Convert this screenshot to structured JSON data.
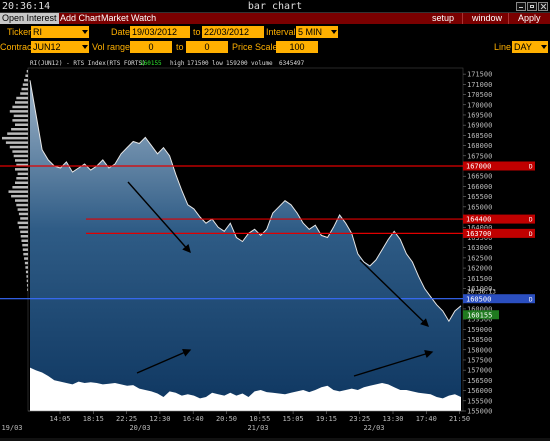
{
  "titlebar": {
    "time": "20:36:14",
    "title": "bar chart"
  },
  "menu": {
    "open_interest": "Open Interest",
    "add_chart": "Add Chart",
    "market_watch": "Market Watch",
    "setup": "setup",
    "window": "window",
    "apply": "Apply"
  },
  "toolbar": {
    "ticker_label": "Ticker",
    "ticker_value": "RI",
    "date_label": "Date",
    "date_from": "19/03/2012",
    "to_label": "to",
    "date_to": "22/03/2012",
    "interval_label": "Interval",
    "interval_value": "5 MIN",
    "contract_label": "Contract",
    "contract_value": "JUN12",
    "vol_range_label": "Vol range",
    "vol_from": "0",
    "vol_to_label": "to",
    "vol_to": "0",
    "price_scale_label": "Price Scale",
    "price_scale_value": "100",
    "line_label": "Line",
    "line_value": "DAY"
  },
  "colors": {
    "accent": "#ffb000",
    "menu_bg": "#7a0000",
    "level_line": "#e00000",
    "current_line": "#3a6cff",
    "last_price_bg": "#1f7a1f"
  },
  "chart_data": {
    "type": "area",
    "info": {
      "symbol": "RI(JUN12) - RTS Index(RTS FORTS)",
      "last": "160155",
      "high_label": "high",
      "high": "171500",
      "low_label": "low",
      "low": "159200",
      "volume_label": "volume",
      "volume": "6345497"
    },
    "ylim": [
      155000,
      171800
    ],
    "y_ticks": [
      "171500",
      "171000",
      "170500",
      "170000",
      "169500",
      "169000",
      "168500",
      "168000",
      "167500",
      "167000",
      "166500",
      "166000",
      "165500",
      "165000",
      "164500",
      "164000",
      "163500",
      "163000",
      "162500",
      "162000",
      "161500",
      "161000",
      "160500",
      "160000",
      "159500",
      "159000",
      "158500",
      "158000",
      "157500",
      "157000",
      "156500",
      "156000",
      "155500",
      "155000"
    ],
    "x_ticks": [
      "14:05",
      "18:15",
      "22:25",
      "12:30",
      "16:40",
      "20:50",
      "10:55",
      "15:05",
      "19:15",
      "23:25",
      "13:30",
      "17:40",
      "21:50"
    ],
    "date_labels": [
      "19/03",
      "20/03",
      "21/03",
      "22/03"
    ],
    "levels": [
      {
        "price": 167000,
        "label": "167000",
        "flag": "D",
        "color": "red"
      },
      {
        "price": 164400,
        "label": "164400",
        "flag": "D",
        "color": "red"
      },
      {
        "price": 163700,
        "label": "163700",
        "flag": "D",
        "color": "red"
      },
      {
        "price": 160500,
        "label": "160500",
        "flag": "D",
        "color": "blue",
        "time": "20:36:13"
      }
    ],
    "last_price": "160155",
    "price_series": [
      171200,
      169500,
      167800,
      167300,
      167000,
      166900,
      167200,
      166700,
      166900,
      167100,
      166800,
      167000,
      167300,
      166900,
      167100,
      167600,
      167900,
      168200,
      168100,
      168400,
      168000,
      167600,
      167900,
      167500,
      166600,
      165800,
      165100,
      164900,
      164500,
      164200,
      164400,
      164000,
      163800,
      164200,
      163500,
      163300,
      163700,
      163900,
      163600,
      163900,
      164700,
      165000,
      165300,
      165100,
      164700,
      164200,
      163900,
      164100,
      163600,
      163500,
      164000,
      164600,
      164200,
      163700,
      162700,
      162300,
      162100,
      162400,
      162900,
      163400,
      163800,
      163400,
      162700,
      162300,
      161600,
      161000,
      160600,
      160200,
      159900,
      159400,
      159900,
      160155
    ],
    "volume_series": [
      0.62,
      0.58,
      0.55,
      0.5,
      0.44,
      0.42,
      0.4,
      0.38,
      0.42,
      0.4,
      0.41,
      0.4,
      0.38,
      0.39,
      0.4,
      0.38,
      0.36,
      0.37,
      0.32,
      0.3,
      0.28,
      0.25,
      0.2,
      0.28,
      0.26,
      0.22,
      0.24,
      0.22,
      0.18,
      0.2,
      0.26,
      0.24,
      0.22,
      0.26,
      0.22,
      0.25,
      0.2,
      0.28,
      0.3,
      0.27,
      0.26,
      0.25,
      0.24,
      0.26,
      0.28,
      0.3,
      0.27,
      0.3,
      0.34,
      0.36,
      0.3,
      0.28,
      0.3,
      0.32,
      0.3,
      0.34,
      0.36,
      0.38,
      0.4,
      0.38,
      0.34,
      0.3,
      0.3,
      0.28,
      0.26,
      0.25,
      0.24,
      0.2,
      0.18,
      0.22,
      0.24,
      0.2
    ],
    "profile": [
      0.05,
      0.1,
      0.15,
      0.2,
      0.25,
      0.3,
      0.45,
      0.5,
      0.6,
      0.7,
      0.55,
      0.6,
      0.5,
      0.65,
      0.8,
      1.0,
      0.85,
      0.7,
      0.6,
      0.55,
      0.5,
      0.45,
      0.5,
      0.4,
      0.45,
      0.5,
      0.6,
      0.75,
      0.65,
      0.5,
      0.45,
      0.4,
      0.35,
      0.3,
      0.4,
      0.35,
      0.3,
      0.28,
      0.25,
      0.22,
      0.2,
      0.18,
      0.15,
      0.12,
      0.1,
      0.08,
      0.06,
      0.05,
      0.04,
      0.03
    ]
  }
}
